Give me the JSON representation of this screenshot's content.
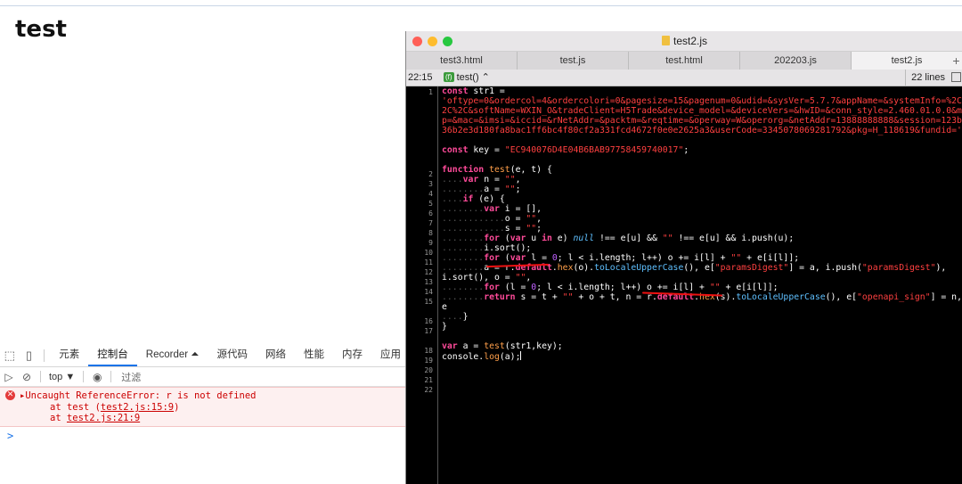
{
  "page": {
    "title": "test"
  },
  "devtools": {
    "tabs": [
      "元素",
      "控制台",
      "Recorder ⏶",
      "源代码",
      "网络",
      "性能",
      "内存",
      "应用"
    ],
    "active_tab": "控制台",
    "context": "top ▼",
    "filter_placeholder": "过滤",
    "error": {
      "message": "▸Uncaught ReferenceError: r is not defined",
      "stack1_prefix": "at test (",
      "stack1_link": "test2.js:15:9",
      "stack1_suffix": ")",
      "stack2_prefix": "at ",
      "stack2_link": "test2.js:21:9"
    },
    "prompt": ">"
  },
  "editor": {
    "window_title": "test2.js",
    "tabs": [
      "test3.html",
      "test.js",
      "test.html",
      "202203.js",
      "test2.js"
    ],
    "active_tab_index": 4,
    "cursor_pos": "22:15",
    "function_selector": "test() ⌃",
    "function_badge": "(f)",
    "line_count": "22 lines",
    "line_numbers": [
      "1",
      "2",
      "3",
      "4",
      "5",
      "6",
      "7",
      "8",
      "9",
      "10",
      "11",
      "12",
      "13",
      "14",
      "15",
      "16",
      "17",
      "18",
      "19",
      "20",
      "21",
      "22"
    ]
  },
  "colors": {
    "close": "#ff5f57",
    "minimize": "#febc2e",
    "zoom": "#28c840",
    "error_text": "#cc0000",
    "accent": "#1a73e8"
  }
}
